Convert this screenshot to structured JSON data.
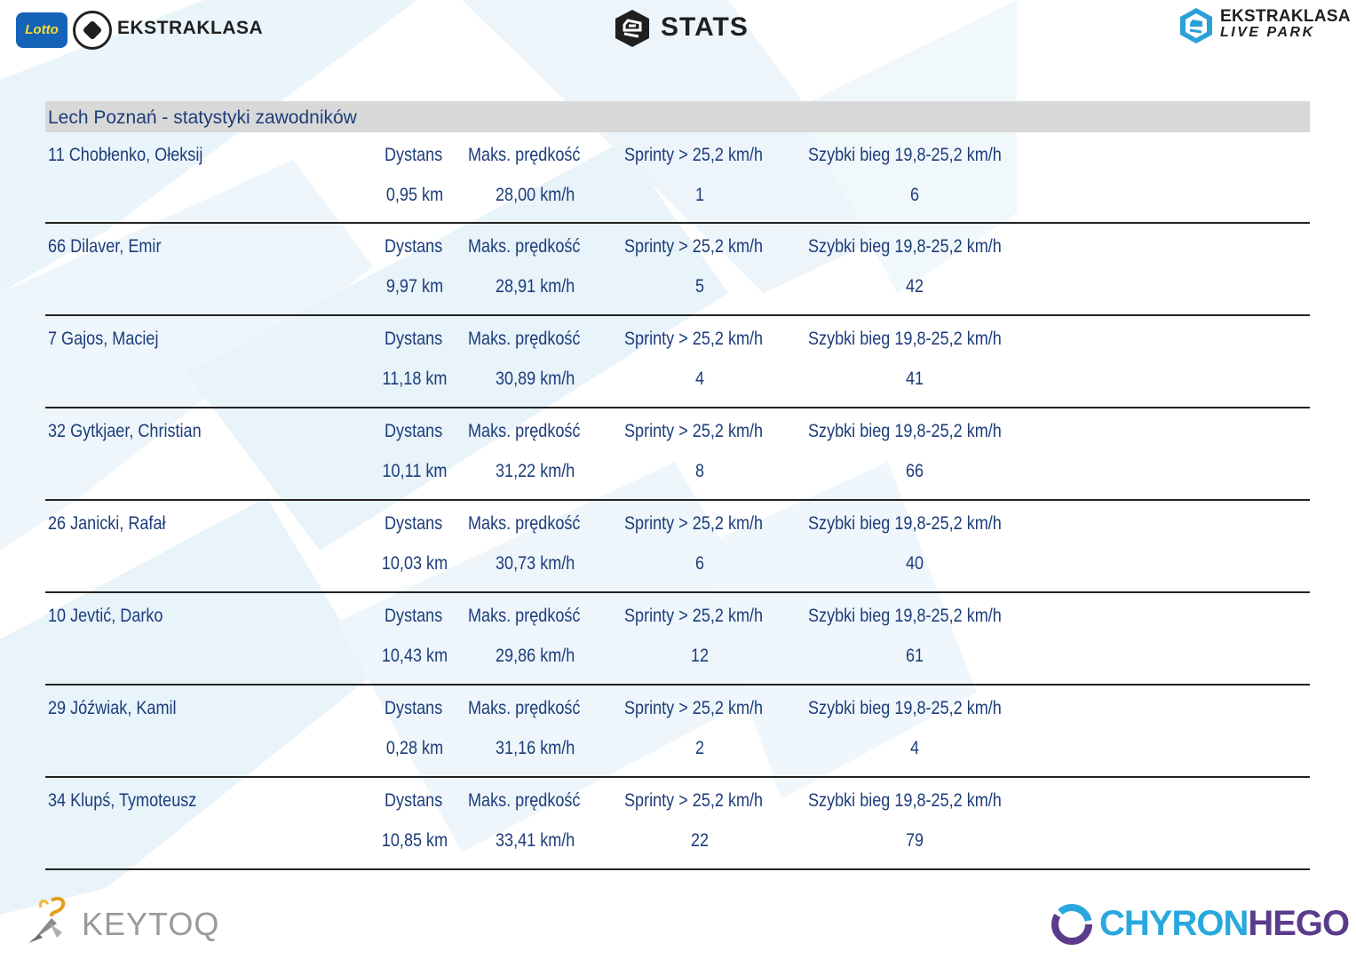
{
  "header": {
    "lotto_label": "Lotto",
    "ekstraklasa_label": "EKSTRAKLASA",
    "stats_label": "STATS",
    "livepark_line1": "EKSTRAKLASA",
    "livepark_line2": "LIVE PARK"
  },
  "table": {
    "title": "Lech Poznań - statystyki zawodników",
    "labels": {
      "distance": "Dystans",
      "max_speed": "Maks. prędkość",
      "sprints": "Sprinty > 25,2 km/h",
      "fast_run": "Szybki bieg 19,8-25,2 km/h"
    },
    "rows": [
      {
        "player": "11  Chobłenko, Ołeksij",
        "distance": "0,95 km",
        "max_speed": "28,00 km/h",
        "sprints": "1",
        "fast_run": "6"
      },
      {
        "player": "66  Dilaver, Emir",
        "distance": "9,97 km",
        "max_speed": "28,91 km/h",
        "sprints": "5",
        "fast_run": "42"
      },
      {
        "player": "7  Gajos, Maciej",
        "distance": "11,18 km",
        "max_speed": "30,89 km/h",
        "sprints": "4",
        "fast_run": "41"
      },
      {
        "player": "32  Gytkjaer, Christian",
        "distance": "10,11 km",
        "max_speed": "31,22 km/h",
        "sprints": "8",
        "fast_run": "66"
      },
      {
        "player": "26  Janicki, Rafał",
        "distance": "10,03 km",
        "max_speed": "30,73 km/h",
        "sprints": "6",
        "fast_run": "40"
      },
      {
        "player": "10  Jevtić, Darko",
        "distance": "10,43 km",
        "max_speed": "29,86 km/h",
        "sprints": "12",
        "fast_run": "61"
      },
      {
        "player": "29  Jóźwiak, Kamil",
        "distance": "0,28 km",
        "max_speed": "31,16 km/h",
        "sprints": "2",
        "fast_run": "4"
      },
      {
        "player": "34  Klupś, Tymoteusz",
        "distance": "10,85 km",
        "max_speed": "33,41 km/h",
        "sprints": "22",
        "fast_run": "79"
      }
    ]
  },
  "footer": {
    "keytoq_label": "KEYTOQ",
    "chyron_part1": "CHYRON",
    "chyron_part2": "HEGO"
  },
  "colors": {
    "text": "#1d3d7a",
    "title_bar": "#d8d8d8",
    "background_shapes": "#e6f2fa",
    "chyron_blue": "#29a8df",
    "chyron_purple": "#5b3b8c"
  }
}
